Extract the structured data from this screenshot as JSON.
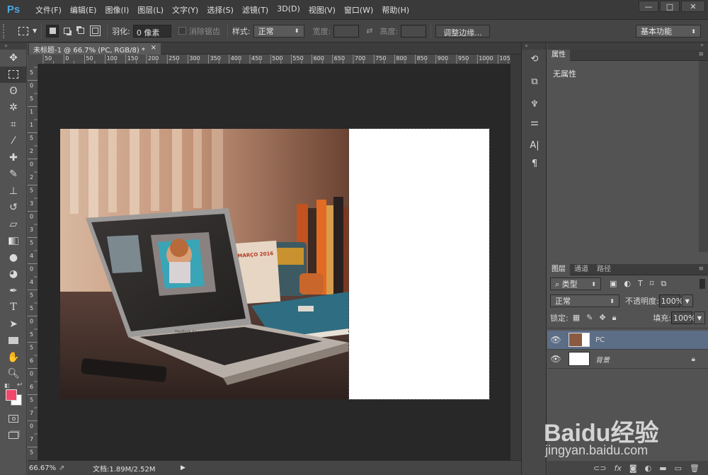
{
  "app": {
    "logo": "Ps"
  },
  "menus": [
    "文件(F)",
    "编辑(E)",
    "图像(I)",
    "图层(L)",
    "文字(Y)",
    "选择(S)",
    "滤镜(T)",
    "3D(D)",
    "视图(V)",
    "窗口(W)",
    "帮助(H)"
  ],
  "window_buttons": {
    "minimize": "—",
    "maximize": "□",
    "close": "✕"
  },
  "options": {
    "feather_label": "羽化:",
    "feather_value": "0 像素",
    "antialias_label": "消除锯齿",
    "style_label": "样式:",
    "style_value": "正常",
    "width_label": "宽度:",
    "height_label": "高度:",
    "refine_edge": "调整边缘...",
    "workspace": "基本功能"
  },
  "document": {
    "tab_title": "未标题-1 @ 66.7% (PC, RGB/8) *",
    "tab_close": "×",
    "zoom": "66.67%",
    "doc_info": "文档:1.89M/2.52M"
  },
  "ruler": {
    "h_ticks": [
      "50",
      "0",
      "50",
      "100",
      "150",
      "200",
      "250",
      "300",
      "350",
      "400",
      "450",
      "500",
      "550",
      "600",
      "650",
      "700",
      "750",
      "800",
      "850",
      "900",
      "950",
      "1000",
      "1050"
    ],
    "v_ticks": [
      "5",
      "0",
      "5",
      "1",
      "1",
      "5",
      "2",
      "0",
      "2",
      "5",
      "3",
      "0",
      "3",
      "5",
      "4",
      "0",
      "4",
      "5",
      "5",
      "0",
      "5",
      "5",
      "6",
      "0",
      "6",
      "5",
      "7",
      "0",
      "7",
      "5"
    ]
  },
  "properties": {
    "tab": "属性",
    "empty_text": "无属性"
  },
  "layers_panel": {
    "tabs": [
      "图层",
      "通道",
      "路径"
    ],
    "filter_kind": "类型",
    "blend_mode": "正常",
    "opacity_label": "不透明度:",
    "opacity_value": "100%",
    "lock_label": "锁定:",
    "fill_label": "填充:",
    "fill_value": "100%",
    "layers": [
      {
        "name": "PC",
        "selected": true
      },
      {
        "name": "背景",
        "selected": false
      }
    ]
  },
  "photo_overlay": {
    "calendar_text": "MARÇO 2016",
    "laptop_brand": "MacBook Air"
  },
  "watermark": {
    "brand": "Baidu经验",
    "url": "jingyan.baidu.com"
  },
  "colors": {
    "foreground": "#f0476a",
    "background": "#ffffff",
    "selected_layer": "#5c6d86"
  }
}
